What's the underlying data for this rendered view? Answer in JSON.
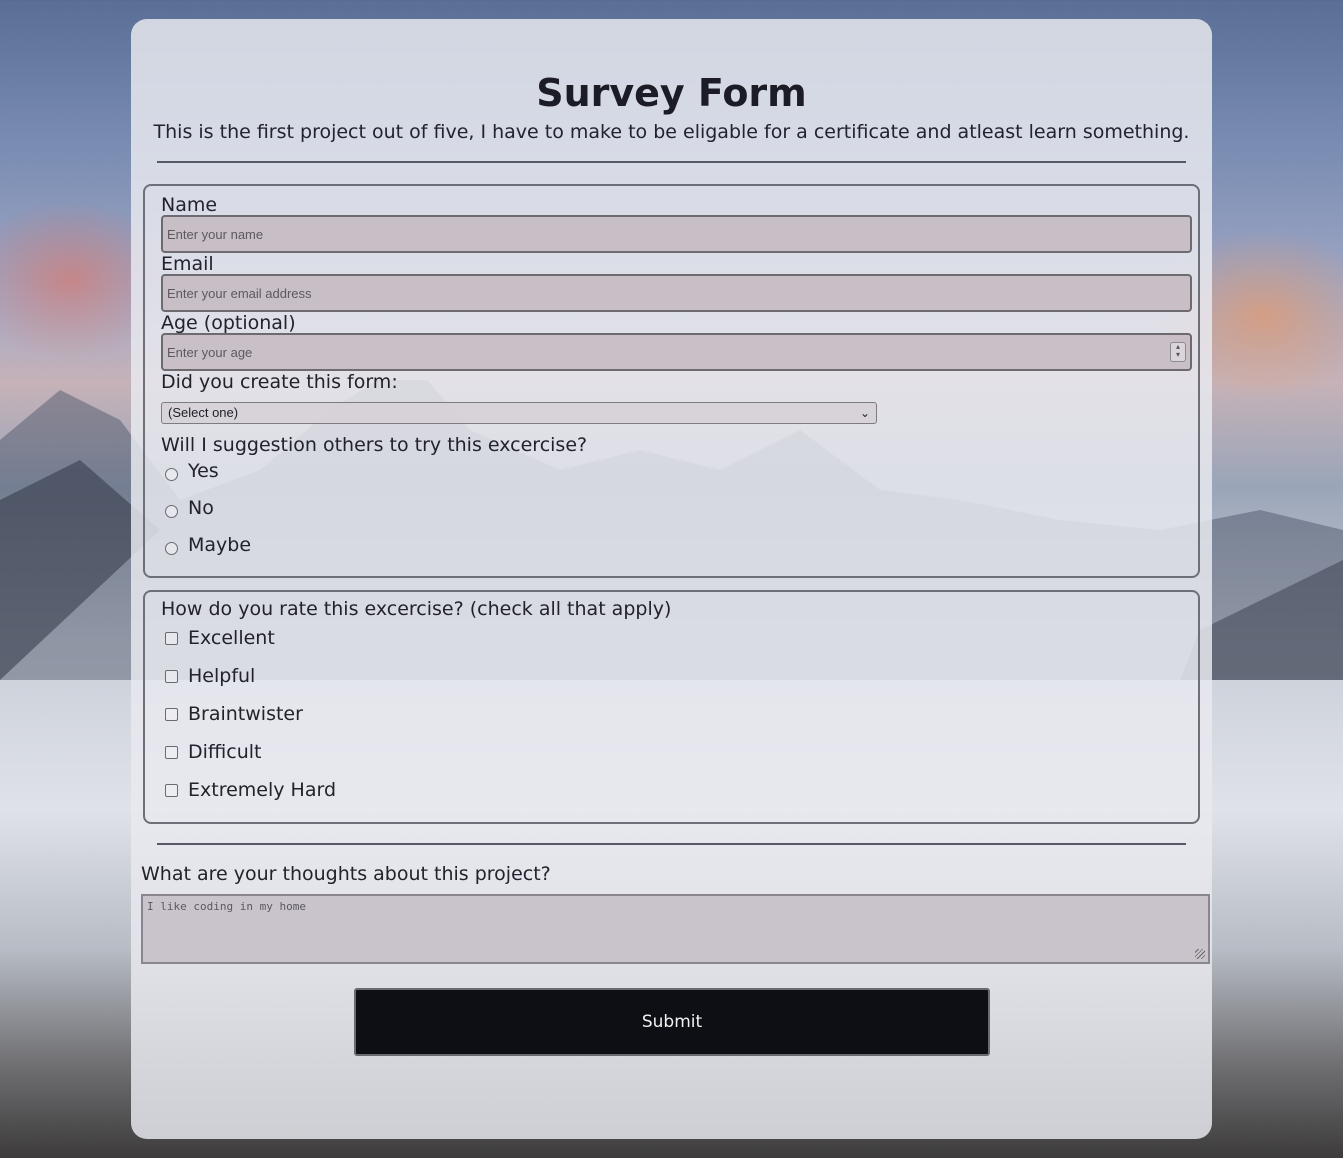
{
  "page": {
    "title": "Survey Form",
    "description": "This is the first project out of five, I have to make to be eligable for a certificate and atleast learn something."
  },
  "personal": {
    "name_label": "Name",
    "name_placeholder": "Enter your name",
    "email_label": "Email",
    "email_placeholder": "Enter your email address",
    "age_label": "Age (optional)",
    "age_placeholder": "Enter your age",
    "created_label": "Did you create this form:",
    "created_selected": "(Select one)",
    "recommend_label": "Will I suggestion others to try this excercise?",
    "recommend_options": [
      "Yes",
      "No",
      "Maybe"
    ]
  },
  "rating": {
    "label": "How do you rate this excercise? (check all that apply)",
    "options": [
      "Excellent",
      "Helpful",
      "Braintwister",
      "Difficult",
      "Extremely Hard"
    ]
  },
  "thoughts": {
    "label": "What are your thoughts about this project?",
    "placeholder": "I like coding in my home"
  },
  "submit": {
    "label": "Submit"
  },
  "icons": {
    "select": "chevron-down-icon",
    "age_spinner": "spinner-icon",
    "textarea_resize": "resize-grip-icon"
  }
}
